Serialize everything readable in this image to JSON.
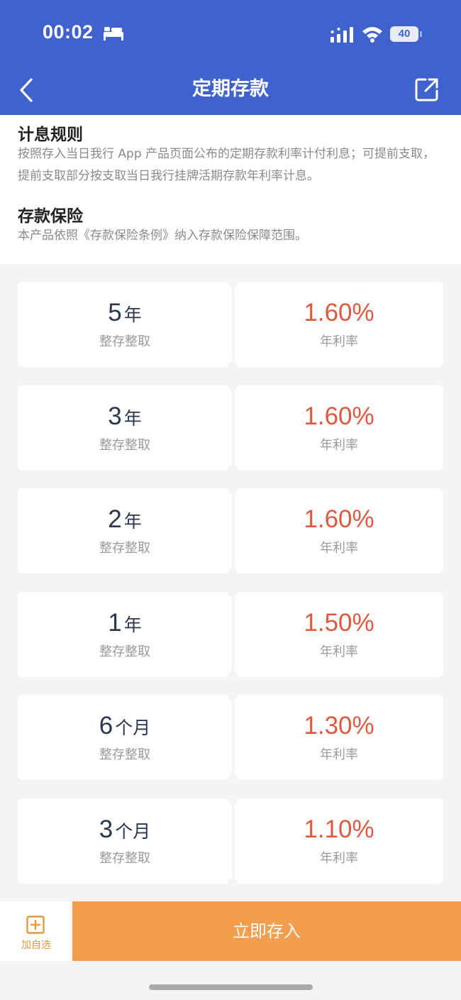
{
  "status_bar": {
    "time": "00:02",
    "battery": "40",
    "icons": [
      "bed-icon",
      "signal-icon",
      "wifi-icon",
      "battery-icon"
    ]
  },
  "nav": {
    "title": "定期存款",
    "back_icon": "chevron-left-icon",
    "share_icon": "share-icon"
  },
  "info": {
    "rule_title": "计息规则",
    "rule_text": "按照存入当日我行 App 产品页面公布的定期存款利率计付利息；可提前支取，提前支取部分按支取当日我行挂牌活期存款年利率计息。",
    "insurance_title": "存款保险",
    "insurance_text": "本产品依照《存款保险条例》纳入存款保险保障范围。"
  },
  "rates": [
    {
      "term": "5",
      "unit": "年",
      "type": "整存整取",
      "rate": "1.60%",
      "rate_label": "年利率"
    },
    {
      "term": "3",
      "unit": "年",
      "type": "整存整取",
      "rate": "1.60%",
      "rate_label": "年利率"
    },
    {
      "term": "2",
      "unit": "年",
      "type": "整存整取",
      "rate": "1.60%",
      "rate_label": "年利率"
    },
    {
      "term": "1",
      "unit": "年",
      "type": "整存整取",
      "rate": "1.50%",
      "rate_label": "年利率"
    },
    {
      "term": "6",
      "unit": "个月",
      "type": "整存整取",
      "rate": "1.30%",
      "rate_label": "年利率"
    },
    {
      "term": "3",
      "unit": "个月",
      "type": "整存整取",
      "rate": "1.10%",
      "rate_label": "年利率"
    }
  ],
  "bottom": {
    "favorite_label": "加自选",
    "deposit_label": "立即存入"
  },
  "colors": {
    "header": "#3f62cf",
    "rate": "#e0583f",
    "cta": "#f39e4c",
    "favorite": "#e59a3c"
  }
}
